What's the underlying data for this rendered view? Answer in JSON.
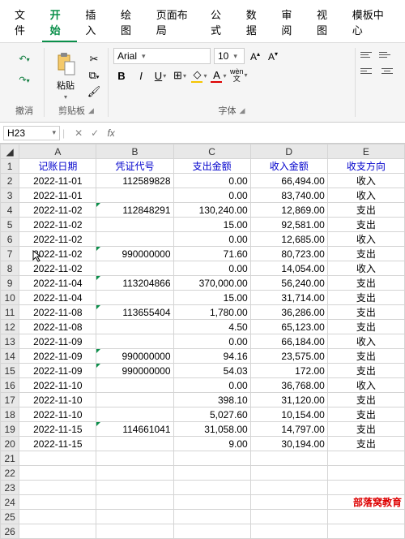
{
  "tabs": [
    "文件",
    "开始",
    "插入",
    "绘图",
    "页面布局",
    "公式",
    "数据",
    "审阅",
    "视图",
    "模板中心"
  ],
  "active_tab": 1,
  "groups": {
    "undo": "撤消",
    "clipboard": "剪贴板",
    "font": "字体",
    "paste_label": "粘贴"
  },
  "font": {
    "name": "Arial",
    "size": "10"
  },
  "wen_label": "wèn\n文",
  "namebox": "H23",
  "columns": [
    "A",
    "B",
    "C",
    "D",
    "E"
  ],
  "headers": [
    "记账日期",
    "凭证代号",
    "支出金额",
    "收入金额",
    "收支方向"
  ],
  "rows": [
    {
      "d": "2022-11-01",
      "c": "112589828",
      "o": "0.00",
      "i": "66,494.00",
      "t": "收入"
    },
    {
      "d": "2022-11-01",
      "c": "",
      "o": "0.00",
      "i": "83,740.00",
      "t": "收入"
    },
    {
      "d": "2022-11-02",
      "c": "112848291",
      "o": "130,240.00",
      "i": "12,869.00",
      "t": "支出",
      "m": 1
    },
    {
      "d": "2022-11-02",
      "c": "",
      "o": "15.00",
      "i": "92,581.00",
      "t": "支出"
    },
    {
      "d": "2022-11-02",
      "c": "",
      "o": "0.00",
      "i": "12,685.00",
      "t": "收入"
    },
    {
      "d": "2022-11-02",
      "c": "990000000",
      "o": "71.60",
      "i": "80,723.00",
      "t": "支出",
      "m": 1,
      "cur": 1
    },
    {
      "d": "2022-11-02",
      "c": "",
      "o": "0.00",
      "i": "14,054.00",
      "t": "收入"
    },
    {
      "d": "2022-11-04",
      "c": "113204866",
      "o": "370,000.00",
      "i": "56,240.00",
      "t": "支出",
      "m": 1
    },
    {
      "d": "2022-11-04",
      "c": "",
      "o": "15.00",
      "i": "31,714.00",
      "t": "支出"
    },
    {
      "d": "2022-11-08",
      "c": "113655404",
      "o": "1,780.00",
      "i": "36,286.00",
      "t": "支出",
      "m": 1
    },
    {
      "d": "2022-11-08",
      "c": "",
      "o": "4.50",
      "i": "65,123.00",
      "t": "支出"
    },
    {
      "d": "2022-11-09",
      "c": "",
      "o": "0.00",
      "i": "66,184.00",
      "t": "收入"
    },
    {
      "d": "2022-11-09",
      "c": "990000000",
      "o": "94.16",
      "i": "23,575.00",
      "t": "支出",
      "m": 1
    },
    {
      "d": "2022-11-09",
      "c": "990000000",
      "o": "54.03",
      "i": "172.00",
      "t": "支出",
      "m": 1
    },
    {
      "d": "2022-11-10",
      "c": "",
      "o": "0.00",
      "i": "36,768.00",
      "t": "收入"
    },
    {
      "d": "2022-11-10",
      "c": "",
      "o": "398.10",
      "i": "31,120.00",
      "t": "支出"
    },
    {
      "d": "2022-11-10",
      "c": "",
      "o": "5,027.60",
      "i": "10,154.00",
      "t": "支出"
    },
    {
      "d": "2022-11-15",
      "c": "114661041",
      "o": "31,058.00",
      "i": "14,797.00",
      "t": "支出",
      "m": 1
    },
    {
      "d": "2022-11-15",
      "c": "",
      "o": "9.00",
      "i": "30,194.00",
      "t": "支出"
    }
  ],
  "empty_rows": [
    21,
    22,
    23,
    24,
    25,
    26
  ],
  "watermark": "部落窝教育"
}
